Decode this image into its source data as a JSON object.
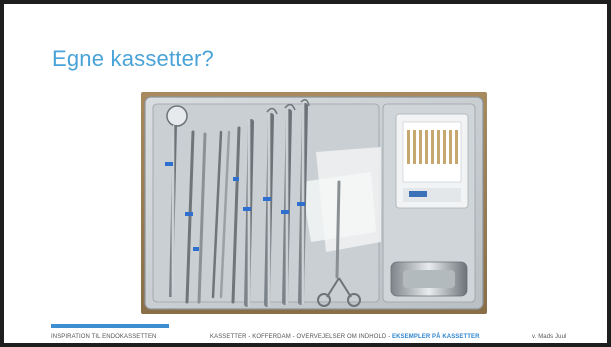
{
  "slide": {
    "title": "Egne kassetter?"
  },
  "photo": {
    "alt": "Dental instrument cassette tray"
  },
  "footer": {
    "left": "INSPIRATION TIL ENDOKASSETTEN",
    "nav": [
      {
        "label": "KASSETTER",
        "active": false
      },
      {
        "label": "KOFFERDAM",
        "active": false
      },
      {
        "label": "OVERVEJELSER OM INDHOLD",
        "active": false
      },
      {
        "label": "EKSEMPLER PÅ KASSETTER",
        "active": true
      }
    ],
    "separator": "-",
    "right": "v. Mads Juul"
  },
  "colors": {
    "title": "#4aa3d8",
    "accent_bar": "#3d8fd1",
    "active_nav": "#2f86cf"
  }
}
